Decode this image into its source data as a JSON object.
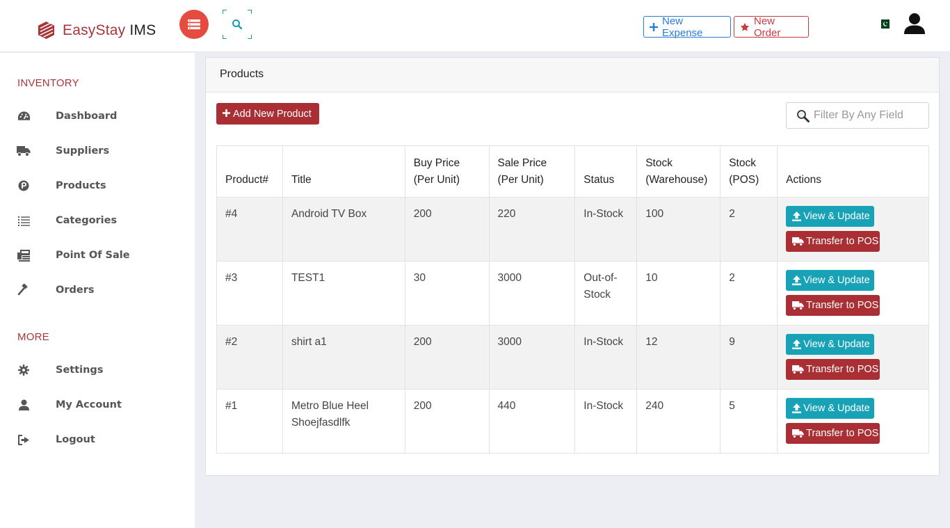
{
  "app": {
    "brand_part1": "EasyStay",
    "brand_part2": " IMS"
  },
  "topbar": {
    "new_expense": "New Expense",
    "new_order": "New Order"
  },
  "sidebar": {
    "section_inventory": "INVENTORY",
    "section_more": "MORE",
    "items": [
      {
        "label": "Dashboard",
        "icon": "dashboard-icon"
      },
      {
        "label": "Suppliers",
        "icon": "truck-icon"
      },
      {
        "label": "Products",
        "icon": "product-icon"
      },
      {
        "label": "Categories",
        "icon": "list-icon"
      },
      {
        "label": "Point Of Sale",
        "icon": "pos-icon"
      },
      {
        "label": "Orders",
        "icon": "gavel-icon"
      }
    ],
    "more_items": [
      {
        "label": "Settings",
        "icon": "gear-icon"
      },
      {
        "label": "My Account",
        "icon": "user-icon"
      },
      {
        "label": "Logout",
        "icon": "logout-icon"
      }
    ]
  },
  "main": {
    "title": "Products",
    "add_button": "Add New Product",
    "filter_placeholder": "Filter By Any Field",
    "columns": [
      "Product#",
      "Title",
      "Buy Price (Per Unit)",
      "Sale Price (Per Unit)",
      "Status",
      "Stock (Warehouse)",
      "Stock (POS)",
      "Actions"
    ],
    "column_lines": [
      [
        "Product#"
      ],
      [
        "Title"
      ],
      [
        "Buy Price",
        "(Per Unit)"
      ],
      [
        "Sale Price",
        "(Per Unit)"
      ],
      [
        "Status"
      ],
      [
        "Stock",
        "(Warehouse)"
      ],
      [
        "Stock",
        "(POS)"
      ],
      [
        "Actions"
      ]
    ],
    "rows": [
      {
        "id": "#4",
        "title": "Android TV Box",
        "buy": "200",
        "sale": "220",
        "status": "In-Stock",
        "stock_wh": "100",
        "stock_pos": "2"
      },
      {
        "id": "#3",
        "title": "TEST1",
        "buy": "30",
        "sale": "3000",
        "status": "Out-of-Stock",
        "stock_wh": "10",
        "stock_pos": "2"
      },
      {
        "id": "#2",
        "title": "shirt a1",
        "buy": "200",
        "sale": "3000",
        "status": "In-Stock",
        "stock_wh": "12",
        "stock_pos": "9"
      },
      {
        "id": "#1",
        "title": "Metro Blue Heel Shoejfasdlfk",
        "buy": "200",
        "sale": "440",
        "status": "In-Stock",
        "stock_wh": "240",
        "stock_pos": "5"
      }
    ],
    "view_label": "View & Update",
    "transfer_label": "Transfer to POS"
  },
  "colors": {
    "brand_red": "#a8353a",
    "accent_teal": "#17a2b8",
    "toggle_red": "#e54b3f",
    "expense_blue": "#2a7dd6"
  }
}
